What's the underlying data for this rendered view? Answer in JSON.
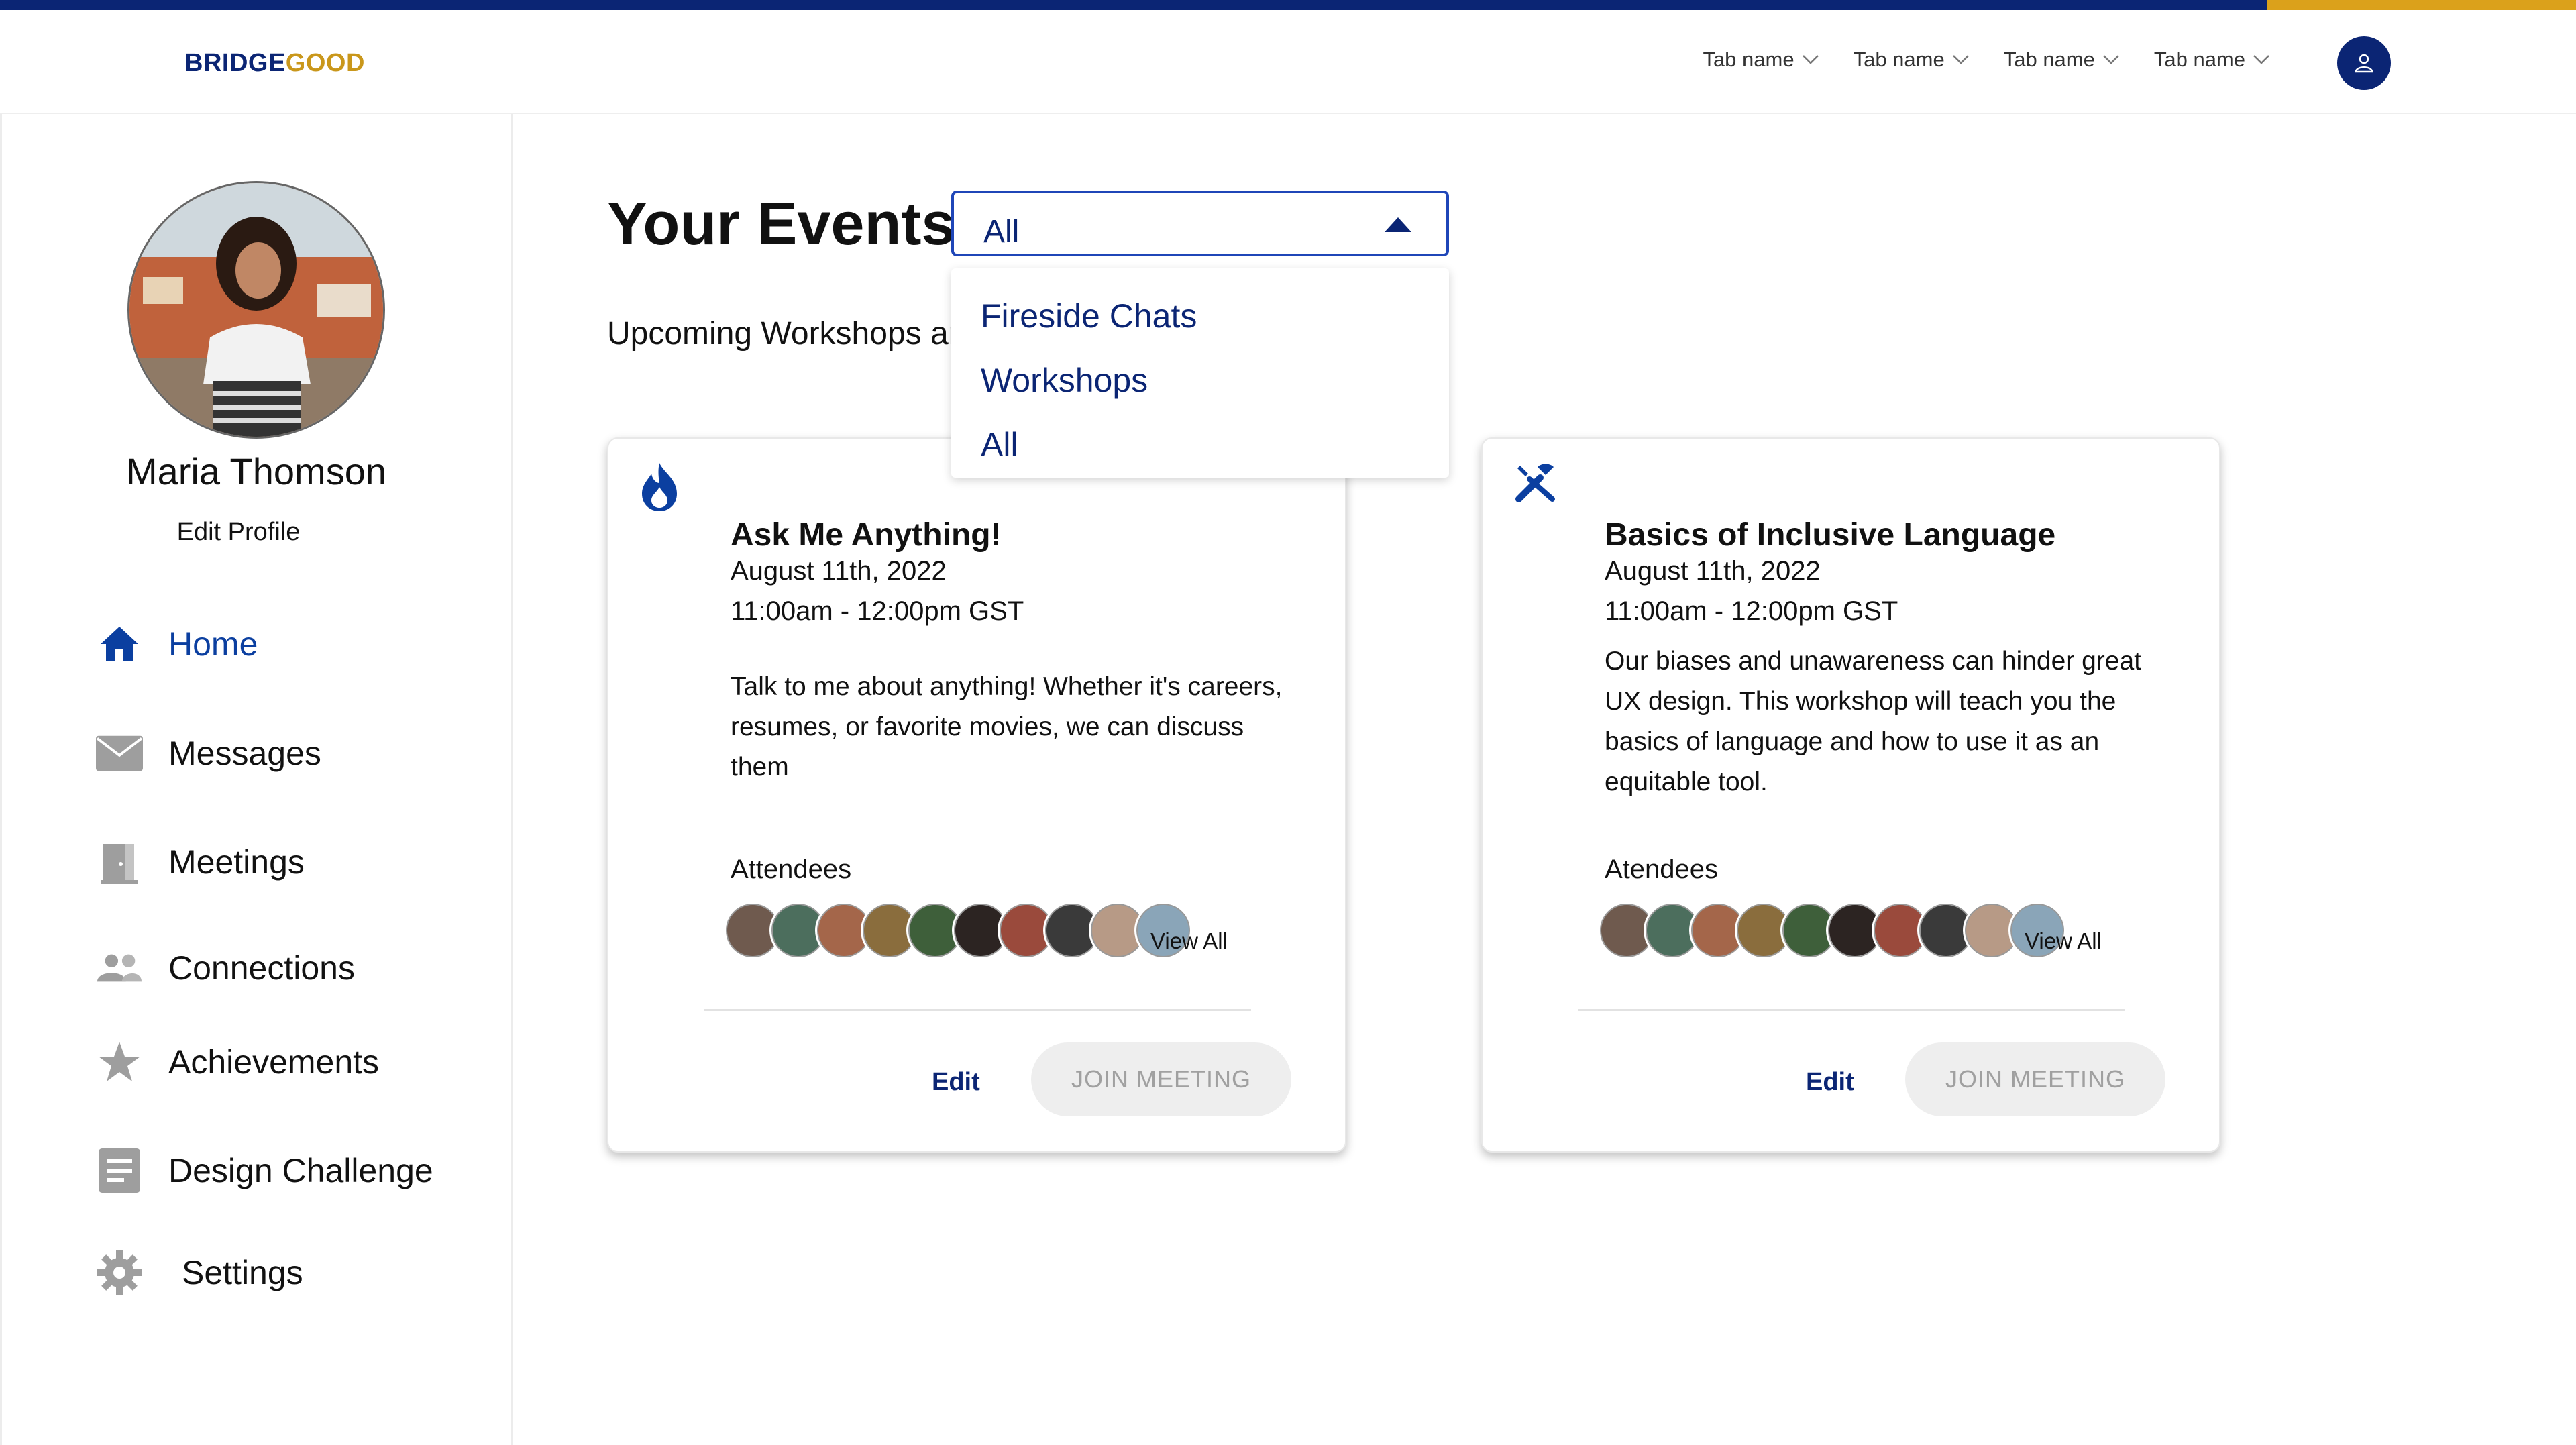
{
  "brand": {
    "name_part1": "BRIDGE",
    "name_part2": "GOOD"
  },
  "header": {
    "tabs": [
      {
        "label": "Tab name"
      },
      {
        "label": "Tab name"
      },
      {
        "label": "Tab name"
      },
      {
        "label": "Tab name"
      }
    ],
    "account_icon": "user-icon"
  },
  "colors": {
    "navy": "#0b2574",
    "gold": "#dba11b",
    "accent_blue": "#1f46b8"
  },
  "sidebar": {
    "profile": {
      "name": "Maria Thomson",
      "edit_label": "Edit Profile"
    },
    "items": [
      {
        "label": "Home",
        "icon": "home-icon",
        "active": true
      },
      {
        "label": "Messages",
        "icon": "mail-icon"
      },
      {
        "label": "Meetings",
        "icon": "door-icon"
      },
      {
        "label": "Connections",
        "icon": "people-icon"
      },
      {
        "label": "Achievements",
        "icon": "star-icon"
      },
      {
        "label": "Design Challenge",
        "icon": "document-icon"
      },
      {
        "label": "Settings",
        "icon": "gear-icon"
      }
    ]
  },
  "main": {
    "title": "Your Events",
    "subtitle": "Upcoming Workshops and Fireside Chats",
    "filter": {
      "selected": "All",
      "options": [
        "Fireside Chats",
        "Workshops",
        "All"
      ]
    },
    "cards": [
      {
        "icon": "flame-icon",
        "title": "Ask Me Anything!",
        "date": "August 11th, 2022",
        "time": "11:00am - 12:00pm GST",
        "description": "Talk to me about anything! Whether it's careers, resumes, or favorite movies, we can discuss them",
        "attendees_label": "Attendees",
        "view_all": "View All",
        "edit": "Edit",
        "join": "JOIN MEETING"
      },
      {
        "icon": "tools-icon",
        "title": "Basics of Inclusive Language",
        "date": "August 11th, 2022",
        "time": "11:00am - 12:00pm GST",
        "description": "Our biases and unawareness can hinder great UX design. This workshop will teach you the basics of language and how to use it as an equitable tool.",
        "attendees_label": "Atendees",
        "view_all": "View All",
        "edit": "Edit",
        "join": "JOIN MEETING"
      }
    ]
  }
}
